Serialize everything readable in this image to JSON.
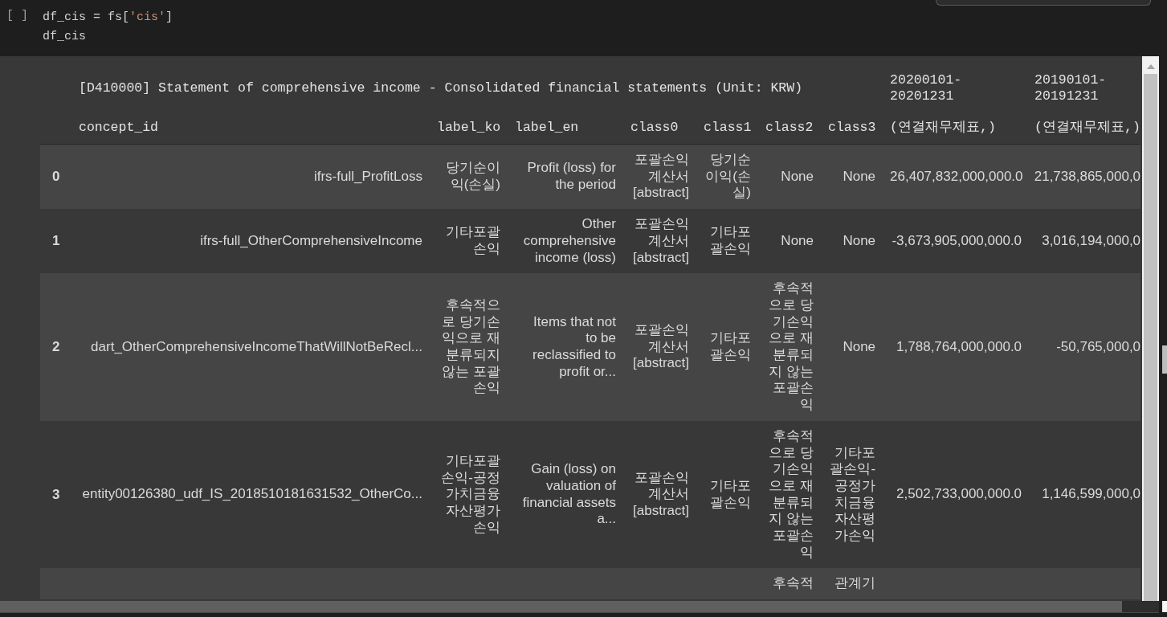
{
  "code_cell": {
    "run_marker": "[ ]",
    "lines": [
      [
        {
          "kind": "plain",
          "text": "df_cis = fs["
        },
        {
          "kind": "string",
          "text": "'cis'"
        },
        {
          "kind": "plain",
          "text": "]"
        }
      ],
      [
        {
          "kind": "plain",
          "text": "df_cis"
        }
      ]
    ]
  },
  "output_table": {
    "title": "[D410000] Statement of comprehensive income - Consolidated financial statements (Unit: KRW)",
    "periods": [
      "20200101-20201231",
      "20190101-20191231"
    ],
    "columns": [
      "concept_id",
      "label_ko",
      "label_en",
      "class0",
      "class1",
      "class2",
      "class3",
      "(연결재무제표,)",
      "(연결재무제표,)"
    ],
    "rows": [
      {
        "index": "0",
        "concept": "ifrs-full_ProfitLoss",
        "korean_label": "당기순이익(손실)",
        "english_label": "Profit (loss) for the period",
        "class_0": "포괄손익계산서 [abstract]",
        "class_1": "당기순이익(손실)",
        "class_2": "None",
        "class_3": "None",
        "amount_1": "26,407,832,000,000.0",
        "amount_2": "21,738,865,000,0"
      },
      {
        "index": "1",
        "concept": "ifrs-full_OtherComprehensiveIncome",
        "korean_label": "기타포괄손익",
        "english_label": "Other comprehensive income (loss)",
        "class_0": "포괄손익계산서 [abstract]",
        "class_1": "기타포괄손익",
        "class_2": "None",
        "class_3": "None",
        "amount_1": "-3,673,905,000,000.0",
        "amount_2": "3,016,194,000,0"
      },
      {
        "index": "2",
        "concept": "dart_OtherComprehensiveIncomeThatWillNotBeRecl...",
        "korean_label": "후속적으로 당기손익으로 재분류되지 않는 포괄손익",
        "english_label": "Items that not to be reclassified to profit or...",
        "class_0": "포괄손익계산서 [abstract]",
        "class_1": "기타포괄손익",
        "class_2": "후속적으로 당기손익으로 재분류되지 않는 포괄손익",
        "class_3": "None",
        "amount_1": "1,788,764,000,000.0",
        "amount_2": "-50,765,000,0"
      },
      {
        "index": "3",
        "concept": "entity00126380_udf_IS_2018510181631532_OtherCo...",
        "korean_label": "기타포괄손익-공정가치금융자산평가손익",
        "english_label": "Gain (loss) on valuation of financial assets a...",
        "class_0": "포괄손익계산서 [abstract]",
        "class_1": "기타포괄손익",
        "class_2": "후속적으로 당기손익으로 재분류되지 않는 포괄손익",
        "class_3": "기타포괄손익-공정가치금융자산평가손익",
        "amount_1": "2,502,733,000,000.0",
        "amount_2": "1,146,599,000,0"
      },
      {
        "class_2": "후속적",
        "class_3": "관계기"
      }
    ]
  }
}
